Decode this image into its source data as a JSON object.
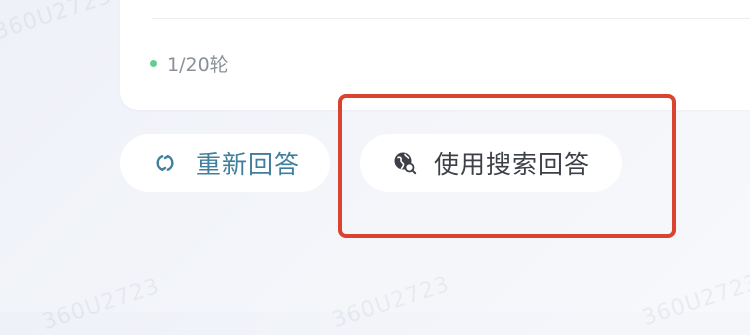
{
  "watermarks": [
    "360U2723",
    "360U2723",
    "360U2723",
    "360U2723",
    "360U2723"
  ],
  "status": {
    "dot_color": "#63cf8f",
    "round_text": "1/20轮"
  },
  "actions": {
    "regenerate": {
      "label": "重新回答",
      "icon": "refresh-icon",
      "color": "#3f7f9b"
    },
    "search_answer": {
      "label": "使用搜索回答",
      "icon": "globe-search-icon",
      "color": "#3d4047"
    }
  },
  "annotation": {
    "color": "#d9432f"
  }
}
